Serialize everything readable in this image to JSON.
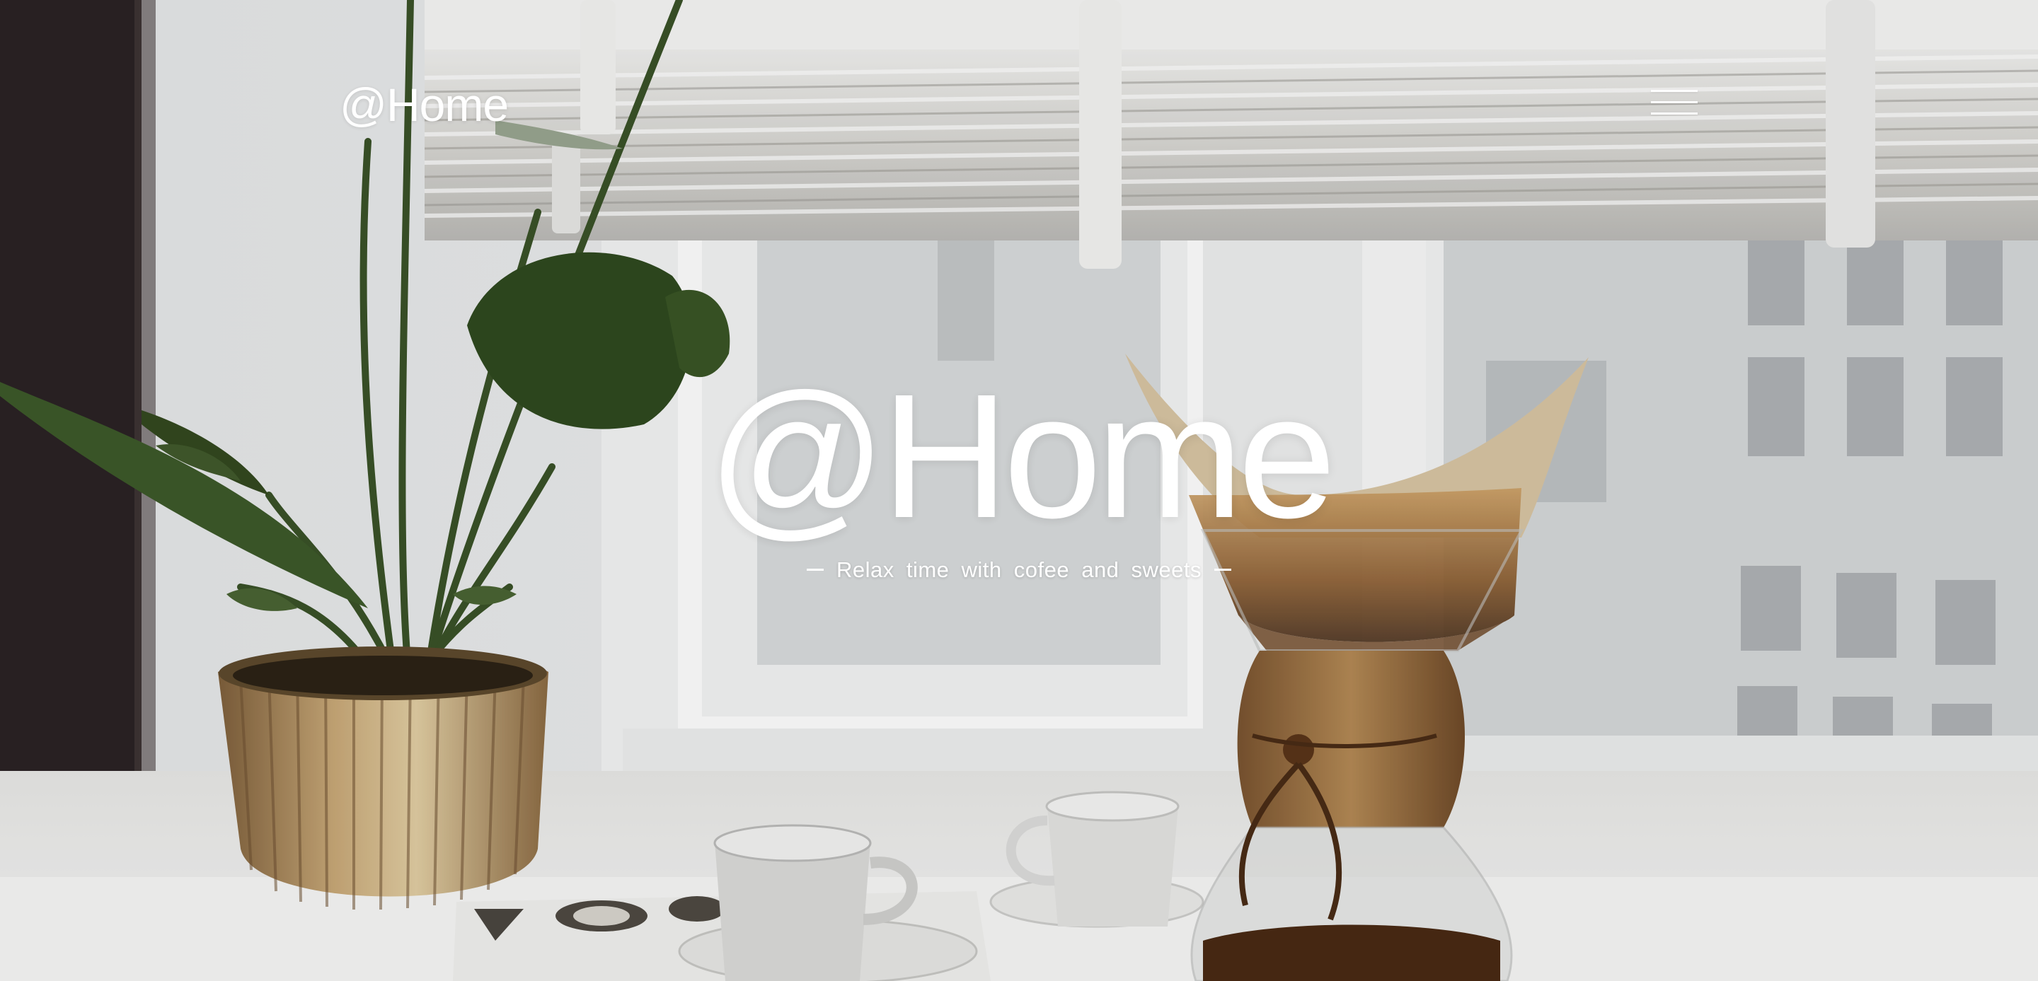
{
  "header": {
    "brand": "@Home",
    "menu_icon": "hamburger-menu-icon"
  },
  "hero": {
    "title": "@Home",
    "tagline": "Relax time with cofee and sweets"
  },
  "colors": {
    "text": "#ffffff",
    "background": "#e9eaea"
  }
}
